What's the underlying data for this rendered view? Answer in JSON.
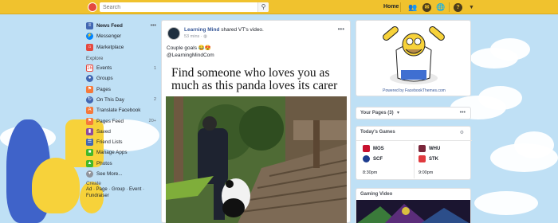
{
  "topbar": {
    "search_placeholder": "Search",
    "search_button_icon": "magnifier-icon",
    "home_label": "Home",
    "icons": [
      "friends-icon",
      "messenger-icon",
      "notifications-icon",
      "help-icon",
      "dropdown-icon"
    ]
  },
  "sidebar": {
    "items": [
      {
        "label": "News Feed",
        "icon": "news-feed-icon",
        "color": "#4267b2",
        "more": "•••"
      },
      {
        "label": "Messenger",
        "icon": "messenger-icon",
        "color": "#0084ff"
      },
      {
        "label": "Marketplace",
        "icon": "marketplace-icon",
        "color": "#e4483e"
      }
    ],
    "explore_heading": "Explore",
    "explore": [
      {
        "label": "Events",
        "icon": "events-icon",
        "color": "#e4483e",
        "count": "1"
      },
      {
        "label": "Groups",
        "icon": "groups-icon",
        "color": "#4267b2"
      },
      {
        "label": "Pages",
        "icon": "pages-icon",
        "color": "#f5793a"
      },
      {
        "label": "On This Day",
        "icon": "on-this-day-icon",
        "color": "#4267b2",
        "count": "2"
      },
      {
        "label": "Translate Facebook",
        "icon": "translate-icon",
        "color": "#f5793a"
      },
      {
        "label": "Pages Feed",
        "icon": "pages-feed-icon",
        "color": "#f5793a",
        "count": "20+"
      },
      {
        "label": "Saved",
        "icon": "saved-icon",
        "color": "#8c4ba0"
      },
      {
        "label": "Friend Lists",
        "icon": "friend-lists-icon",
        "color": "#4267b2"
      },
      {
        "label": "Manage Apps",
        "icon": "manage-apps-icon",
        "color": "#42b72a"
      },
      {
        "label": "Photos",
        "icon": "photos-icon",
        "color": "#42b72a"
      },
      {
        "label": "See More...",
        "icon": "see-more-icon",
        "color": "#90949c"
      }
    ],
    "create_heading": "Create",
    "create_links": "Ad · Page · Group · Event · Fundraiser"
  },
  "post": {
    "author": "Learning Mind",
    "action": " shared VT's video.",
    "time": "53 mins · ",
    "more": "•••",
    "caption_line1": "Couple goals 😂😍",
    "caption_line2": "@LearningMindCom",
    "headline": "Find someone who loves you as much as this panda loves its carer"
  },
  "right": {
    "theme_credit": "Powered by FacebookThemes.com",
    "your_pages": "Your Pages (3)",
    "your_pages_more": "•••",
    "todays_games": "Today's Games",
    "games": [
      {
        "team1": "MOS",
        "team1_color": "#c8102e",
        "team2": "SCF",
        "team2_color": "#1d3c8f",
        "time": "8:30pm"
      },
      {
        "team1": "WHU",
        "team1_color": "#7a263a",
        "team2": "STK",
        "team2_color": "#e03a3e",
        "time": "9:00pm"
      }
    ],
    "gaming_video": "Gaming Video"
  }
}
